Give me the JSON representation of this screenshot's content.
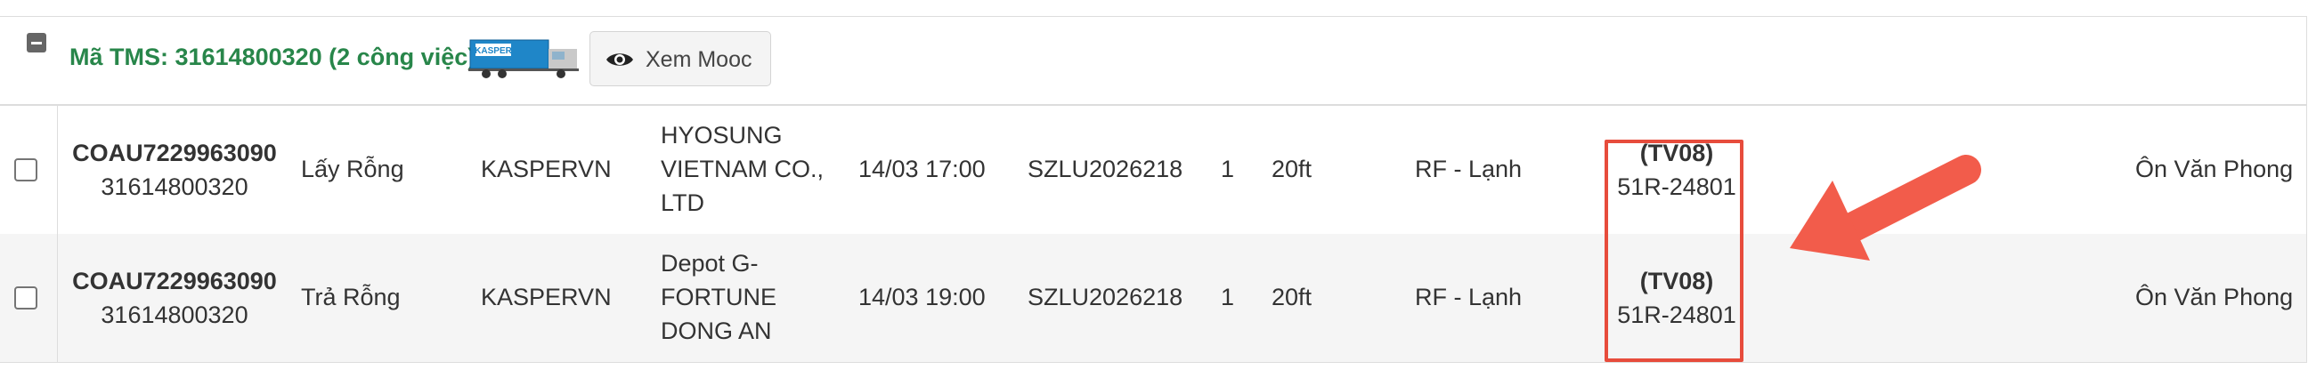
{
  "group": {
    "title": "Mã TMS: 31614800320 (2 công việc)",
    "truck_icon": "kasper-truck-icon",
    "truck_brand": "KASPER",
    "view_trailer_button": "Xem Mooc",
    "eye_icon": "eye-icon"
  },
  "rows": [
    {
      "container_code": "COAU7229963090",
      "tms_code": "31614800320",
      "action": "Lấy Rỗng",
      "customer": "KASPERVN",
      "place": "HYOSUNG VIETNAM CO., LTD",
      "time": "14/03 17:00",
      "container_no": "SZLU2026218",
      "quantity": "1",
      "size": "20ft",
      "type": "RF - Lạnh",
      "vehicle_code": "(TV08)",
      "plate": "51R-24801",
      "driver": "Ôn Văn Phong"
    },
    {
      "container_code": "COAU7229963090",
      "tms_code": "31614800320",
      "action": "Trả Rỗng",
      "customer": "KASPERVN",
      "place": "Depot G-FORTUNE DONG AN",
      "time": "14/03 19:00",
      "container_no": "SZLU2026218",
      "quantity": "1",
      "size": "20ft",
      "type": "RF - Lạnh",
      "vehicle_code": "(TV08)",
      "plate": "51R-24801",
      "driver": "Ôn Văn Phong"
    }
  ],
  "annotation": {
    "highlight_color": "#e74c3c",
    "arrow_color": "#f25c4b"
  }
}
